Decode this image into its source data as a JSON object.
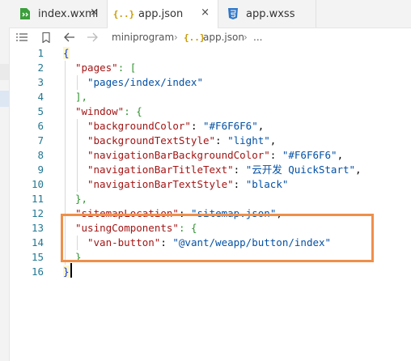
{
  "tabs": [
    {
      "label": "index.wxml",
      "icon": "wxml-file-icon",
      "close": "×"
    },
    {
      "label": "app.json",
      "icon": "json-file-icon",
      "close": "×"
    },
    {
      "label": "app.wxss",
      "icon": "css-file-icon"
    }
  ],
  "breadcrumb": {
    "items": [
      "miniprogram",
      "app.json",
      "..."
    ],
    "json_icon_text": "{..}",
    "separator": "›"
  },
  "toolbar_icons": [
    "list-icon",
    "bookmark-icon",
    "back-arrow-icon",
    "forward-arrow-icon"
  ],
  "line_numbers": [
    "1",
    "2",
    "3",
    "4",
    "5",
    "6",
    "7",
    "8",
    "9",
    "10",
    "11",
    "12",
    "13",
    "14",
    "15",
    "16"
  ],
  "code": {
    "l1": "{",
    "l2_key": "\"pages\"",
    "l2_rest": ": [",
    "l3": "\"pages/index/index\"",
    "l4": "],",
    "l5_key": "\"window\"",
    "l5_rest": ": {",
    "l6_key": "\"backgroundColor\"",
    "l6_val": "\"#F6F6F6\"",
    "l7_key": "\"backgroundTextStyle\"",
    "l7_val": "\"light\"",
    "l8_key": "\"navigationBarBackgroundColor\"",
    "l8_val": "\"#F6F6F6\"",
    "l9_key": "\"navigationBarTitleText\"",
    "l9_val": "\"云开发 QuickStart\"",
    "l10_key": "\"navigationBarTextStyle\"",
    "l10_val": "\"black\"",
    "l11": "},",
    "l12_key": "\"sitemapLocation\"",
    "l12_val": "\"sitemap.json\"",
    "l13_key": "\"usingComponents\"",
    "l13_rest": ": {",
    "l14_key": "\"van-button\"",
    "l14_val": "\"@vant/weapp/button/index\"",
    "l15": "}",
    "l16": "}"
  },
  "colors": {
    "highlight_box": "#ef8f4a",
    "key": "#a31515",
    "string": "#0451a5",
    "line_number": "#237893"
  }
}
